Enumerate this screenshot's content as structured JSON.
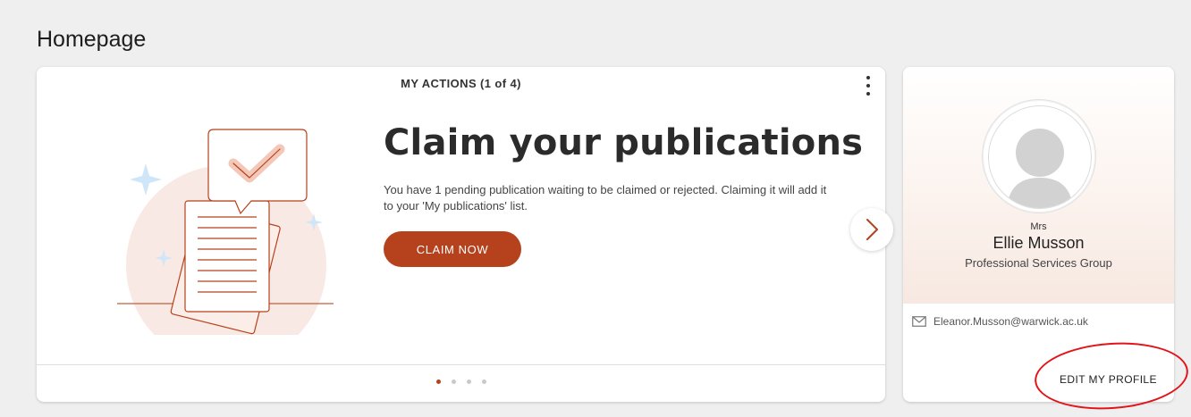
{
  "page": {
    "title": "Homepage"
  },
  "actions": {
    "header": "MY ACTIONS (1 of 4)",
    "title": "Claim your publications",
    "description": "You have 1 pending publication waiting to be claimed or rejected. Claiming it will add it to your 'My publications' list.",
    "button_label": "CLAIM NOW",
    "pagination": {
      "total": 4,
      "active": 1
    },
    "accent_color": "#b5421c"
  },
  "profile": {
    "prefix": "Mrs",
    "name": "Ellie Musson",
    "group": "Professional Services Group",
    "email": "Eleanor.Musson@warwick.ac.uk",
    "edit_label": "EDIT MY PROFILE"
  },
  "annotation": {
    "color": "#e2141a"
  },
  "icons": [
    "kebab-menu-icon",
    "chevron-right-icon",
    "envelope-icon",
    "avatar-placeholder-icon",
    "checkmark-icon"
  ]
}
